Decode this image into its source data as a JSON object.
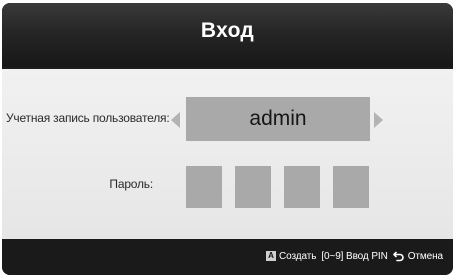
{
  "dialog": {
    "title": "Вход"
  },
  "form": {
    "user_label": "Учетная запись пользователя:",
    "user_value": "admin",
    "password_label": "Пароль:",
    "pin_length": 4
  },
  "footer": {
    "hints": [
      {
        "key": "A",
        "label": "Создать",
        "key_color": "#cfcfcf"
      },
      {
        "key": "",
        "label": "[0~9] Ввод PIN"
      },
      {
        "key": "return-icon",
        "label": "Отмена"
      }
    ]
  },
  "colors": {
    "title_bar": "#262626",
    "content_bg": "#ececec",
    "field_bg": "#a9a9a9",
    "footer_bg": "#1a1a1a"
  }
}
